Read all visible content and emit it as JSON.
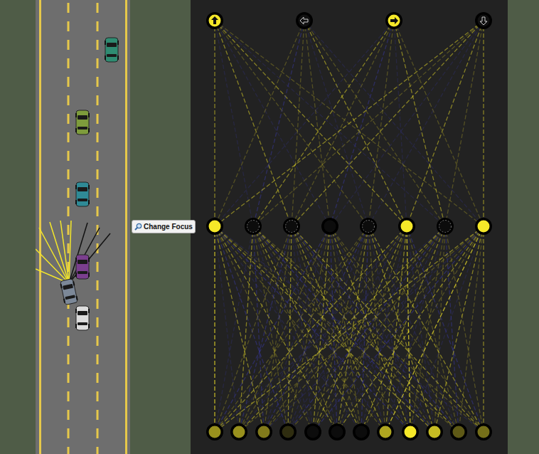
{
  "simulation": {
    "cars": [
      {
        "color": "#2f8c72",
        "focused": false
      },
      {
        "color": "#7e9c3c",
        "focused": false
      },
      {
        "color": "#2f8a96",
        "focused": false
      },
      {
        "color": "#7b3f8e",
        "focused": false
      },
      {
        "color": "#7c8898",
        "focused": true
      },
      {
        "color": "#dcdcdc",
        "focused": false
      }
    ],
    "sensors": [
      {
        "detected": true
      },
      {
        "detected": true
      },
      {
        "detected": true
      },
      {
        "detected": true
      },
      {
        "detected": true
      },
      {
        "detected": true
      },
      {
        "detected": false
      },
      {
        "detected": false
      },
      {
        "detected": false
      }
    ]
  },
  "buttons": [
    "Change Focus"
  ],
  "network": {
    "outputs": [
      {
        "name": "up",
        "on": true
      },
      {
        "name": "left",
        "on": false
      },
      {
        "name": "right",
        "on": true
      },
      {
        "name": "down",
        "on": false
      }
    ],
    "hidden": [
      {
        "level": 1,
        "dashed": false
      },
      {
        "level": 0,
        "dashed": true
      },
      {
        "level": 0,
        "dashed": true
      },
      {
        "level": 0,
        "dashed": false
      },
      {
        "level": 0,
        "dashed": true
      },
      {
        "level": 1,
        "dashed": false
      },
      {
        "level": 0,
        "dashed": true
      },
      {
        "level": 1,
        "dashed": false
      }
    ],
    "inputs": [
      {
        "level": 0.6
      },
      {
        "level": 0.6
      },
      {
        "level": 0.5
      },
      {
        "level": 0.15
      },
      {
        "level": 0
      },
      {
        "level": 0
      },
      {
        "level": 0
      },
      {
        "level": 0.7
      },
      {
        "level": 1
      },
      {
        "level": 0.8
      },
      {
        "level": 0.35
      },
      {
        "level": 0.45
      }
    ],
    "hiddenWeights": [
      [
        0.9,
        -0.3,
        0.6,
        -0.6,
        0.3,
        0.6,
        -0.3,
        0.3,
        -0.6,
        0.6,
        0.3,
        -0.3
      ],
      [
        -0.3,
        0.6,
        -0.6,
        0.3,
        -0.3,
        0.3,
        0.6,
        -0.3,
        0.3,
        -0.6,
        0.6,
        0.3
      ],
      [
        0.3,
        -0.6,
        0.3,
        0.6,
        -0.3,
        -0.3,
        0.3,
        0.6,
        -0.3,
        0.3,
        -0.6,
        0.6
      ],
      [
        -0.6,
        0.3,
        -0.3,
        0.3,
        0.6,
        -0.6,
        0.3,
        -0.3,
        0.6,
        -0.3,
        0.3,
        0.3
      ],
      [
        0.3,
        0.3,
        -0.6,
        -0.3,
        0.3,
        0.6,
        -0.6,
        0.3,
        -0.3,
        0.6,
        -0.3,
        0.6
      ],
      [
        0.6,
        -0.3,
        0.3,
        -0.3,
        0.6,
        0.3,
        -0.3,
        0.6,
        0.9,
        -0.3,
        0.3,
        -0.6
      ],
      [
        -0.3,
        0.6,
        0.3,
        -0.6,
        0.3,
        -0.3,
        0.6,
        -0.3,
        0.3,
        0.3,
        -0.6,
        0.3
      ],
      [
        0.6,
        0.3,
        -0.3,
        0.3,
        -0.6,
        0.6,
        0.3,
        0.9,
        -0.3,
        0.6,
        0.3,
        0.6
      ]
    ],
    "outputWeights": [
      [
        0.6,
        -0.3,
        0.6,
        -0.3,
        0.3,
        0.6,
        -0.3,
        0.3
      ],
      [
        0.3,
        -0.6,
        0.3,
        0.3,
        -0.3,
        0.6,
        0.3,
        -0.3
      ],
      [
        -0.3,
        0.6,
        0.3,
        -0.6,
        0.3,
        -0.3,
        0.6,
        0.3
      ],
      [
        0.6,
        0.3,
        0.6,
        -0.3,
        -0.3,
        0.6,
        0.3,
        0.6
      ]
    ]
  }
}
